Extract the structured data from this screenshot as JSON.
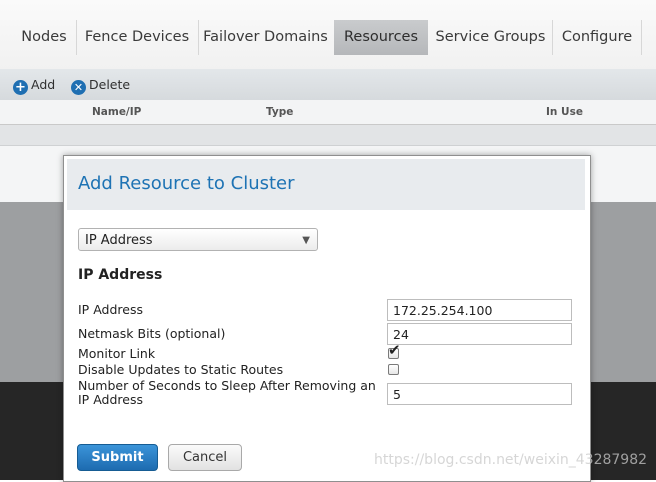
{
  "tabs": [
    {
      "label": "Nodes",
      "active": false
    },
    {
      "label": "Fence Devices",
      "active": false
    },
    {
      "label": "Failover Domains",
      "active": false
    },
    {
      "label": "Resources",
      "active": true
    },
    {
      "label": "Service Groups",
      "active": false
    },
    {
      "label": "Configure",
      "active": false
    }
  ],
  "toolbar": {
    "add_label": "Add",
    "delete_label": "Delete",
    "add_icon": "plus-circle-icon",
    "delete_icon": "x-circle-icon"
  },
  "table": {
    "columns": [
      "Name/IP",
      "Type",
      "In Use"
    ]
  },
  "modal": {
    "title": "Add Resource to Cluster",
    "resource_type": "IP Address",
    "section_title": "IP Address",
    "fields": {
      "ip_address": {
        "label": "IP Address",
        "value": "172.25.254.100"
      },
      "netmask_bits": {
        "label": "Netmask Bits (optional)",
        "value": "24"
      },
      "monitor_link": {
        "label": "Monitor Link",
        "checked": true
      },
      "disable_updates": {
        "label": "Disable Updates to Static Routes",
        "checked": false
      },
      "sleep_seconds": {
        "label": "Number of Seconds to Sleep After Removing an IP Address",
        "value": "5"
      }
    },
    "submit_label": "Submit",
    "cancel_label": "Cancel"
  },
  "watermark": "https://blog.csdn.net/weixin_43287982",
  "colors": {
    "accent": "#1e73b4",
    "submit_button": "#1d6bb0",
    "overlay_dark": "#262626"
  }
}
